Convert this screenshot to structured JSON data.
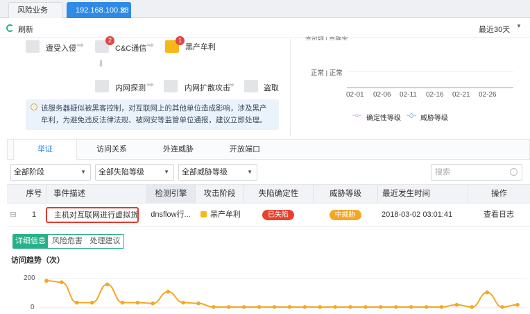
{
  "tabs": [
    {
      "label": "风险业务"
    },
    {
      "label": "192.168.100.28"
    }
  ],
  "toolbar": {
    "refresh": "刷新",
    "range": "最近30天"
  },
  "flow": {
    "nodes": [
      "遭受入侵",
      "C&C通信",
      "黑产牟利",
      "内网探测",
      "内网扩散攻击",
      "盗取敏"
    ],
    "badges": [
      "2",
      "1"
    ]
  },
  "trend_chart": {
    "y_labels": [
      "正常 | 正常"
    ],
    "y_top_label": "高可疑 | 高确定",
    "x_labels": [
      "02-01",
      "02-06",
      "02-11",
      "02-16",
      "02-21",
      "02-26"
    ],
    "legend": [
      "确定性等级",
      "威胁等级"
    ],
    "colors": {
      "certainty": "#b25fd3",
      "threat": "#3e8ce0"
    }
  },
  "tip": "该服务器疑似被黑客控制，对互联网上的其他单位造成影响，涉及黑产牟利，为避免违反法律法规、被网安等监管单位通报，建议立即处理。",
  "section_tabs": [
    "举证",
    "访问关系",
    "外连威胁",
    "开放端口"
  ],
  "filters": {
    "stage": "全部阶段",
    "fall": "全部失陷等级",
    "threat": "全部威胁等级",
    "search_placeholder": "搜索"
  },
  "table": {
    "headers": [
      "序号",
      "事件描述",
      "检测引擎",
      "攻击阶段",
      "失陷确定性",
      "威胁等级",
      "最近发生时间",
      "操作"
    ],
    "row": {
      "expand": "⊟",
      "index": "1",
      "desc": "主机对互联网进行虚拟货币...",
      "engine": "dnsflow行...",
      "stage": "黑产牟利",
      "fall": "已失陷",
      "threat": "中威胁",
      "time": "2018-03-02 03:01:41",
      "action": "查看日志"
    }
  },
  "detail": {
    "tabs": [
      "详细信息",
      "风险危害",
      "处理建议"
    ],
    "title": "访问趋势（次）",
    "y_labels": [
      "200",
      "0"
    ]
  },
  "chart_data": {
    "type": "line",
    "title": "访问趋势（次）",
    "yticks": [
      0,
      200
    ],
    "ylim": [
      0,
      240
    ],
    "values": [
      185,
      175,
      35,
      35,
      160,
      35,
      35,
      30,
      110,
      35,
      30,
      5,
      5,
      5,
      5,
      5,
      5,
      5,
      5,
      5,
      5,
      5,
      5,
      5,
      5,
      5,
      5,
      20,
      5,
      105,
      5,
      20
    ],
    "color": "#f5a623"
  }
}
